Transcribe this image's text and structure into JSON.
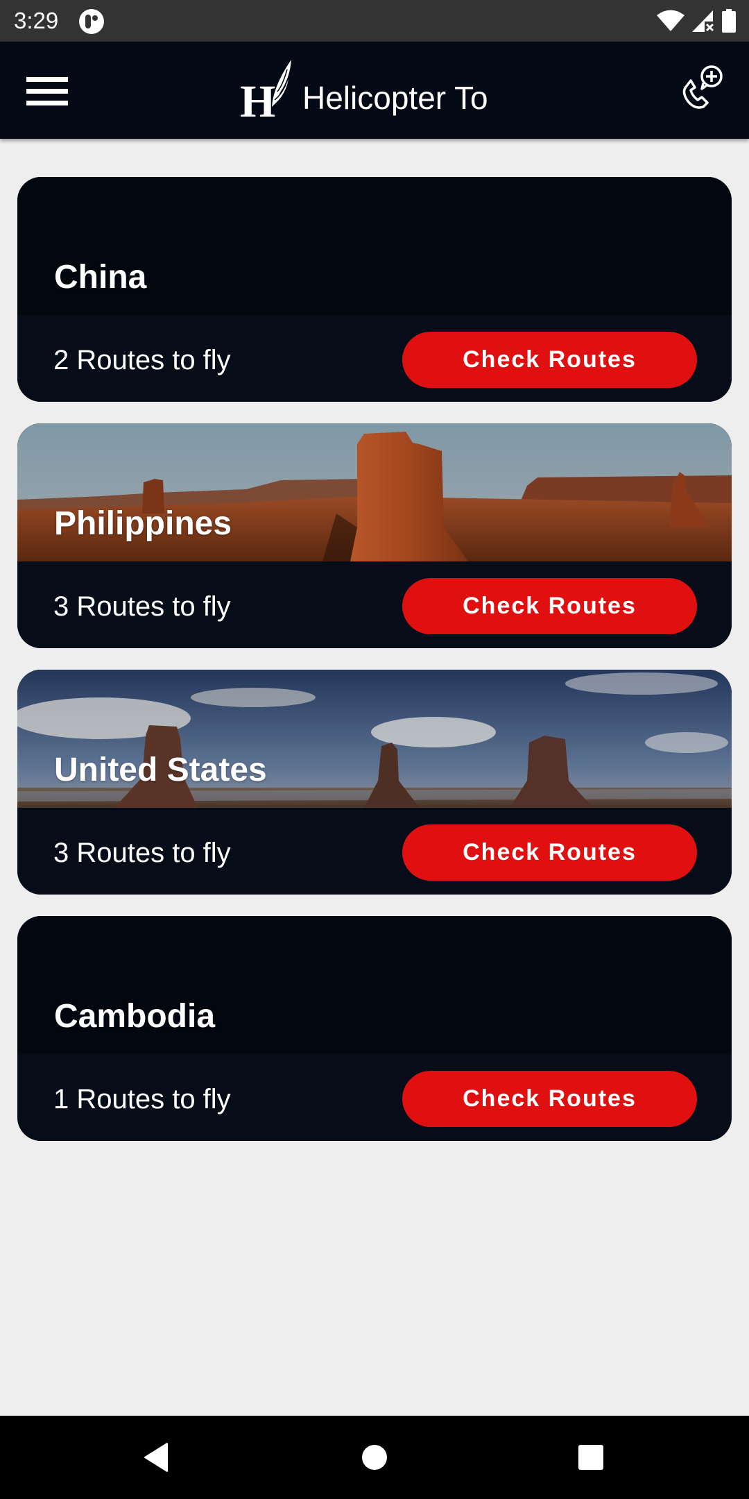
{
  "status_bar": {
    "time": "3:29",
    "icons": [
      "app-notification-icon",
      "wifi-icon",
      "signal-no-sim-icon",
      "battery-icon"
    ]
  },
  "app_bar": {
    "menu_icon": "hamburger-menu-icon",
    "logo_icon": "helicopter-to-logo",
    "title": "Helicopter To",
    "action_icon": "phone-add-icon"
  },
  "destinations": [
    {
      "country": "China",
      "routes_text": "2 Routes to fly",
      "button_label": "Check Routes",
      "image": "none"
    },
    {
      "country": "Philippines",
      "routes_text": "3 Routes to fly",
      "button_label": "Check Routes",
      "image": "desert-mesa-sunset"
    },
    {
      "country": "United States",
      "routes_text": "3 Routes to fly",
      "button_label": "Check Routes",
      "image": "monument-valley-buttes"
    },
    {
      "country": "Cambodia",
      "routes_text": "1 Routes to fly",
      "button_label": "Check Routes",
      "image": "none"
    }
  ],
  "nav_bar": {
    "back_icon": "back-icon",
    "home_icon": "home-icon",
    "recents_icon": "recents-icon"
  },
  "colors": {
    "status_bar": "#333333",
    "app_bar": "#030915",
    "card_bg": "#030711",
    "card_footer": "#060c18",
    "accent_red": "#e01010",
    "page_bg": "#eeeeee"
  }
}
